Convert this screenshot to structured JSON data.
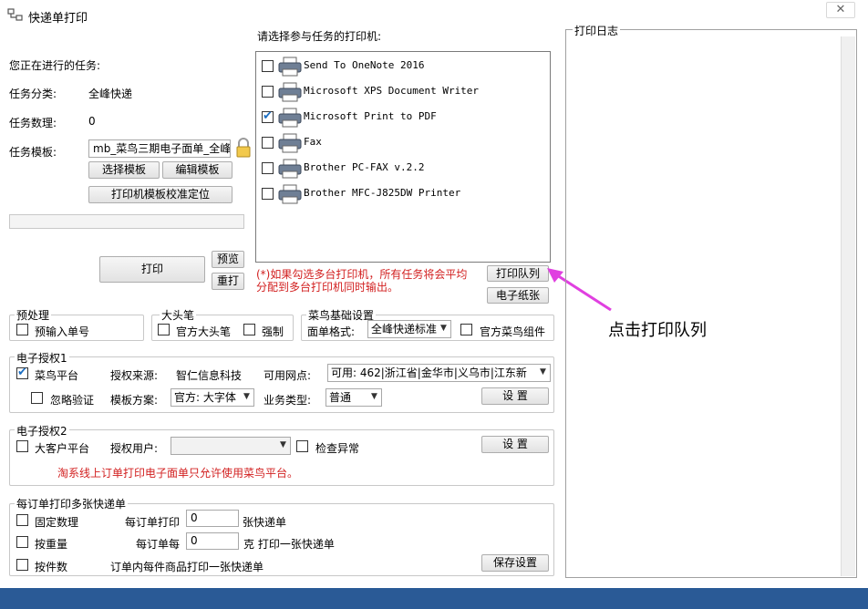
{
  "window": {
    "title": "快递单打印",
    "close_label": "✕"
  },
  "task": {
    "current_label": "您正在进行的任务:",
    "category_label": "任务分类:",
    "category_value": "全峰快递",
    "count_label": "任务数理:",
    "count_value": "0",
    "template_label": "任务模板:",
    "template_value": "mb_菜鸟三期电子面单_全峰"
  },
  "buttons": {
    "select_template": "选择模板",
    "edit_template": "编辑模板",
    "calibrate": "打印机模板校准定位",
    "print": "打印",
    "preview": "预览",
    "reprint": "重打",
    "print_queue": "打印队列",
    "e_paper": "电子纸张",
    "settings1": "设 置",
    "settings2": "设 置",
    "save_settings": "保存设置"
  },
  "printers": {
    "header": "请选择参与任务的打印机:",
    "items": [
      {
        "name": "Send To OneNote 2016",
        "checked": false
      },
      {
        "name": "Microsoft XPS Document Writer",
        "checked": false
      },
      {
        "name": "Microsoft Print to PDF",
        "checked": true
      },
      {
        "name": "Fax",
        "checked": false
      },
      {
        "name": "Brother PC-FAX v.2.2",
        "checked": false
      },
      {
        "name": "Brother MFC-J825DW Printer",
        "checked": false
      }
    ],
    "note": "(*)如果勾选多台打印机，所有任务将会平均分配到多台打印机同时输出。"
  },
  "log": {
    "title": "打印日志"
  },
  "annotation": {
    "text": "点击打印队列",
    "color": "#e040e0"
  },
  "preprocess": {
    "title": "预处理",
    "pre_input": "预输入单号"
  },
  "bigpen": {
    "title": "大头笔",
    "official": "官方大头笔",
    "force": "强制"
  },
  "cainiao_basic": {
    "title": "菜鸟基础设置",
    "format_label": "面单格式:",
    "format_value": "全峰快递标准",
    "official_component": "官方菜鸟组件"
  },
  "auth1": {
    "title": "电子授权1",
    "cainiao_platform": "菜鸟平台",
    "source_label": "授权来源:",
    "source_value": "智仁信息科技",
    "outlet_label": "可用网点:",
    "outlet_value": "可用: 462|浙江省|金华市|义乌市|江东新",
    "ignore_verify": "忽略验证",
    "scheme_label": "模板方案:",
    "scheme_value": "官方: 大字体",
    "biz_label": "业务类型:",
    "biz_value": "普通"
  },
  "auth2": {
    "title": "电子授权2",
    "big_client": "大客户平台",
    "user_label": "授权用户:",
    "check_abnormal": "检查异常",
    "warning": "淘系线上订单打印电子面单只允许使用菜鸟平台。"
  },
  "multi": {
    "title": "每订单打印多张快递单",
    "fixed_qty": "固定数理",
    "per_order_print": "每订单打印",
    "per_order_value": "0",
    "per_order_unit": "张快递单",
    "by_weight": "按重量",
    "per_order_each": "每订单每",
    "weight_value": "0",
    "weight_unit": "克 打印一张快递单",
    "by_pieces": "按件数",
    "pieces_text": "订单内每件商品打印一张快递单"
  },
  "colors": {
    "statusbar": "#2a5a96",
    "warning_red": "#d22020",
    "annotation": "#e040e0",
    "check_blue": "#1b6ec2"
  }
}
